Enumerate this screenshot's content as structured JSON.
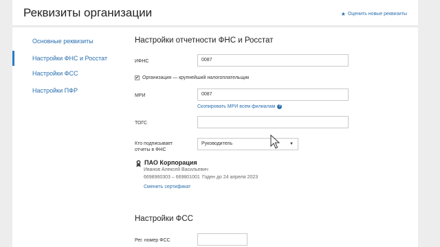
{
  "header": {
    "title": "Реквизиты организации",
    "rate_link": "Оценить новые реквизиты"
  },
  "sidebar": {
    "items": [
      {
        "label": "Основные реквизиты"
      },
      {
        "label": "Настройки ФНС и Росстат"
      },
      {
        "label": "Настройки ФСС"
      },
      {
        "label": "Настройки ПФР"
      }
    ],
    "active_index": 1
  },
  "fns": {
    "title": "Настройки отчетности ФНС и Росстат",
    "ifns_label": "ИФНС",
    "ifns_value": "0087",
    "largest_taxpayer_label": "Организация — крупнейший налогоплательщик",
    "largest_taxpayer_checked": true,
    "mri_label": "МРИ",
    "mri_value": "0087",
    "copy_mri_link": "Скопировать МРИ всем филиалам",
    "togs_label": "ТОГС",
    "togs_value": "",
    "signer_label_line1": "Кто подписывает",
    "signer_label_line2": "отчеты в ФНС",
    "signer_value": "Руководитель"
  },
  "certificate": {
    "org_name": "ПАО Корпорация",
    "person": "Иванов Алексей Васильевич",
    "codes": "6698960303 – 669801001",
    "valid_until": "Годен до 24 апреля 2023",
    "change_link": "Сменить сертификат"
  },
  "fss": {
    "title": "Настройки ФСС",
    "reg_number_label": "Рег. номер ФСС",
    "reg_number_value": ""
  },
  "colors": {
    "accent": "#2a6ead",
    "background": "#ededed",
    "card": "#ffffff"
  }
}
